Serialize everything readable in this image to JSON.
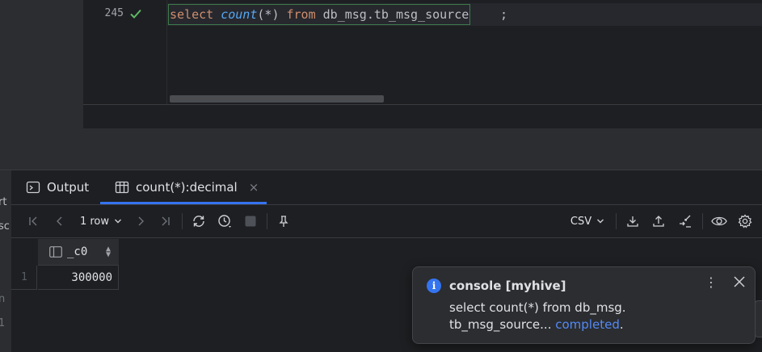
{
  "editor": {
    "line_number": "245",
    "status_icon": "check-icon",
    "code": {
      "kw_select": "select",
      "fn_count": "count",
      "paren_open": "(",
      "star": "*",
      "paren_close": ")",
      "kw_from": "from",
      "table": "db_msg.tb_msg_source",
      "semicolon": ";"
    }
  },
  "left_stub": {
    "fragments": [
      "rt",
      "sc",
      "n",
      "1"
    ]
  },
  "panel": {
    "tabs": [
      {
        "label": "Output",
        "icon": "console-icon"
      },
      {
        "label": "count(*):decimal",
        "icon": "table-icon",
        "close": "×"
      }
    ],
    "toolbar": {
      "rows_label": "1 row",
      "export_format": "CSV",
      "icons": [
        "first-page-icon",
        "prev-page-icon",
        "next-page-icon",
        "last-page-icon",
        "refresh-icon",
        "history-icon",
        "stop-icon",
        "pin-icon",
        "download-icon",
        "upload-icon",
        "compare-icon",
        "view-icon",
        "settings-icon"
      ]
    },
    "grid": {
      "columns": [
        "_c0"
      ],
      "rows": [
        {
          "num": "1",
          "values": [
            "300000"
          ]
        }
      ]
    }
  },
  "notification": {
    "title": "console [myhive]",
    "body_line1": "select count(*) from db_msg.",
    "body_line2": "tb_msg_source...",
    "link": "completed",
    "period": ".",
    "more_icon": "⋮"
  },
  "colors": {
    "accent": "#3574f0",
    "keyword": "#cf8e6d",
    "function": "#56a8f5",
    "success": "#5fb865",
    "link": "#548af7"
  }
}
